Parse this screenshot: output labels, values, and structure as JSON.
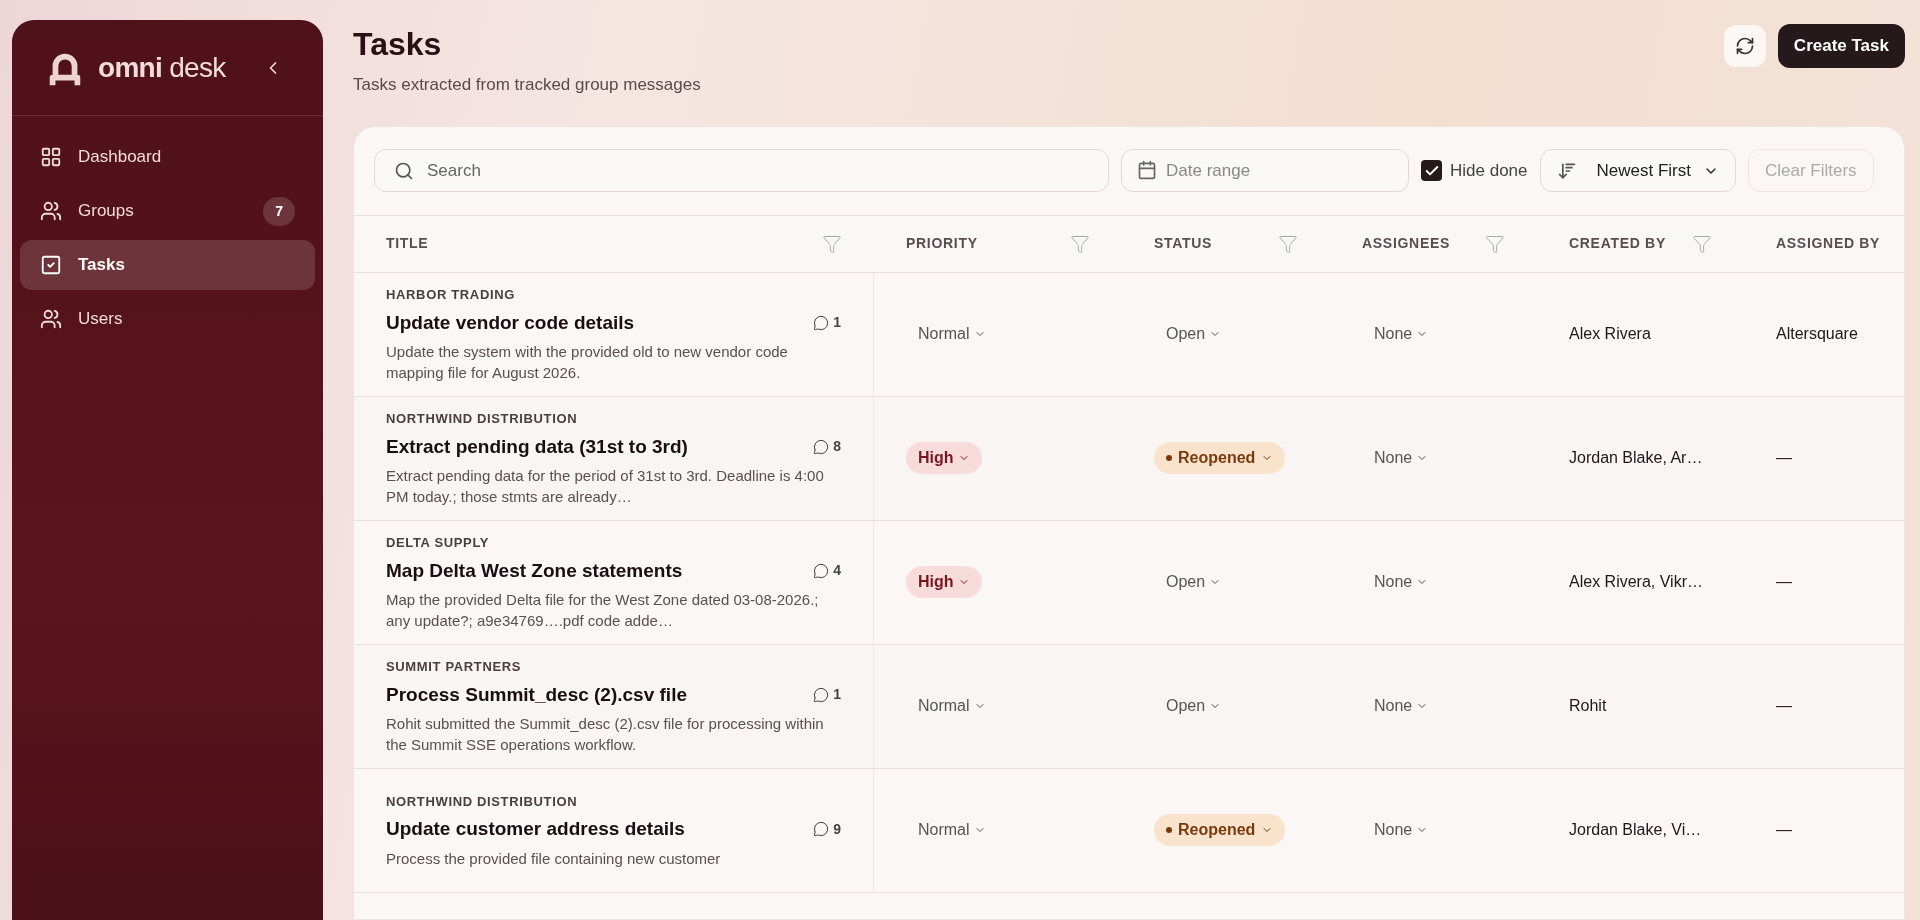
{
  "sidebar": {
    "logo_text_bold": "omni",
    "logo_text": "desk",
    "items": [
      {
        "label": "Dashboard",
        "selected": false
      },
      {
        "label": "Groups",
        "badge": "7",
        "selected": false
      },
      {
        "label": "Tasks",
        "selected": true
      },
      {
        "label": "Users",
        "selected": false
      }
    ]
  },
  "header": {
    "title": "Tasks",
    "subtitle": "Tasks extracted from tracked group messages",
    "create_button": "Create Task"
  },
  "toolbar": {
    "search": {
      "placeholder": "Search"
    },
    "date_range": {
      "placeholder": "Date range"
    },
    "hide_done": {
      "label": "Hide done",
      "checked": true
    },
    "sort": {
      "value": "Newest First"
    },
    "clear_filters": {
      "label": "Clear Filters",
      "disabled": true
    }
  },
  "table": {
    "columns": [
      "TITLE",
      "PRIORITY",
      "STATUS",
      "ASSIGNEES",
      "CREATED BY",
      "ASSIGNED BY"
    ],
    "rows": [
      {
        "group": "HARBOR TRADING",
        "title": "Update vendor code details",
        "comments": "1",
        "description": "Update the system with the provided old to new vendor code mapping file for August 2026.",
        "priority": {
          "label": "Normal",
          "kind": "normal"
        },
        "status": {
          "label": "Open",
          "kind": "open"
        },
        "assignees": "None",
        "created_by": "Alex Rivera",
        "assigned_by": "Altersquare"
      },
      {
        "group": "NORTHWIND DISTRIBUTION",
        "title": "Extract pending data (31st to 3rd)",
        "comments": "8",
        "description": "Extract pending data for the period of 31st to 3rd. Deadline is 4:00 PM today.; those stmts are already…",
        "priority": {
          "label": "High",
          "kind": "high"
        },
        "status": {
          "label": "Reopened",
          "kind": "reopened"
        },
        "assignees": "None",
        "created_by": "Jordan Blake, Ar…",
        "assigned_by": "—"
      },
      {
        "group": "DELTA SUPPLY",
        "title": "Map Delta West Zone statements",
        "comments": "4",
        "description": "Map the provided Delta file for the West Zone dated 03-08-2026.; any update?; a9e34769….pdf code adde…",
        "priority": {
          "label": "High",
          "kind": "high"
        },
        "status": {
          "label": "Open",
          "kind": "open"
        },
        "assignees": "None",
        "created_by": "Alex Rivera, Vikr…",
        "assigned_by": "—"
      },
      {
        "group": "SUMMIT PARTNERS",
        "title": "Process Summit_desc (2).csv file",
        "comments": "1",
        "description": "Rohit submitted the Summit_desc (2).csv file for processing within the Summit SSE operations workflow.",
        "priority": {
          "label": "Normal",
          "kind": "normal"
        },
        "status": {
          "label": "Open",
          "kind": "open"
        },
        "assignees": "None",
        "created_by": "Rohit",
        "assigned_by": "—"
      },
      {
        "group": "NORTHWIND DISTRIBUTION",
        "title": "Update customer address details",
        "comments": "9",
        "description": "Process the provided file containing new customer",
        "priority": {
          "label": "Normal",
          "kind": "normal"
        },
        "status": {
          "label": "Reopened",
          "kind": "reopened"
        },
        "assignees": "None",
        "created_by": "Jordan Blake, Vi…",
        "assigned_by": "—"
      }
    ]
  }
}
